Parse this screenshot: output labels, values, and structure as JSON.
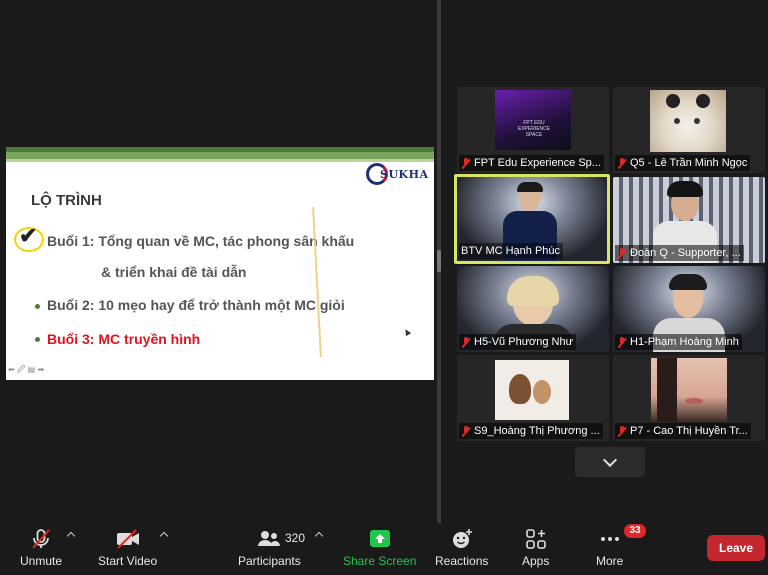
{
  "slide": {
    "logo_text": "SUKHA",
    "title": "LỘ TRÌNH",
    "items": [
      {
        "text": "Buổi 1: Tổng quan về MC, tác phong sân khấu"
      },
      {
        "text": "& triển khai đề tài dẫn"
      },
      {
        "text": "Buổi 2: 10 mẹo hay để trở thành một MC giỏi"
      },
      {
        "text": "Buổi 3: MC truyền hình"
      }
    ],
    "tools_text": "⬅ 🖉 ▤ ➡"
  },
  "participants": [
    {
      "name": "FPT Edu Experience Sp..."
    },
    {
      "name": "Q5 - Lê Trần Minh Ngọc"
    },
    {
      "name": "BTV MC Hạnh Phúc"
    },
    {
      "name": "Đoàn Q - Supporter, ..."
    },
    {
      "name": "H5-Vũ Phương Như"
    },
    {
      "name": "H1-Phạm Hoàng Minh"
    },
    {
      "name": "S9_Hoàng Thị Phương ..."
    },
    {
      "name": "P7 - Cao Thị Huyền Tr..."
    }
  ],
  "fpt_thumb_text": "FPT EDU EXPERIENCE SPACE",
  "toolbar": {
    "unmute": "Unmute",
    "start_video": "Start Video",
    "participants": "Participants",
    "participants_count": "320",
    "share_screen": "Share Screen",
    "reactions": "Reactions",
    "apps": "Apps",
    "more": "More",
    "more_badge": "33",
    "leave": "Leave"
  },
  "colors": {
    "active_speaker_border": "#d7e565",
    "share_green": "#1ec64b",
    "leave_red": "#c4262e",
    "mute_red": "#e02828"
  }
}
